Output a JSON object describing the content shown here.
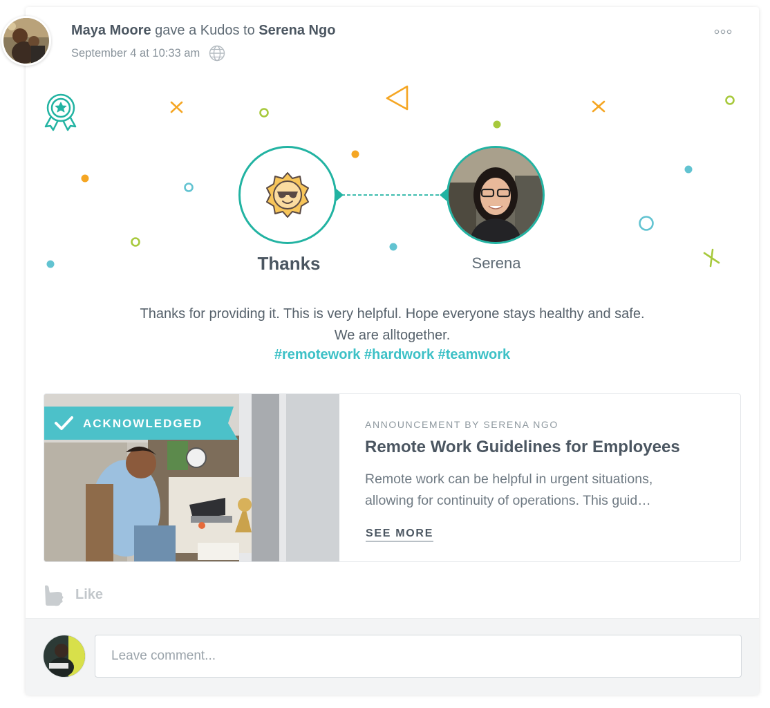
{
  "post": {
    "author": "Maya Moore",
    "action": "gave a Kudos to",
    "recipient": "Serena Ngo",
    "timestamp": "September 4 at 10:33 am",
    "visibility_icon": "globe-icon",
    "more_icon": "more-horizontal-icon"
  },
  "kudos": {
    "badge_icon": "award-ribbon-icon",
    "type_icon": "sun-sunglasses-icon",
    "type_label": "Thanks",
    "recipient_label": "Serena"
  },
  "message": {
    "line1": "Thanks for providing it. This is very helpful. Hope everyone stays healthy and safe.",
    "line2": "We are alltogether.",
    "hashtags": [
      "#remotework",
      "#hardwork",
      "#teamwork"
    ]
  },
  "announcement": {
    "badge_label": "ACKNOWLEDGED",
    "kicker": "ANNOUNCEMENT BY SERENA NGO",
    "title": "Remote Work Guidelines for Employees",
    "desc_line1": "Remote work can be helpful in urgent situations,",
    "desc_line2": "allowing for continuity of operations.  This guid…",
    "see_more": "SEE MORE"
  },
  "actions": {
    "like_label": "Like",
    "like_icon": "thumbs-up-icon"
  },
  "comment": {
    "placeholder": "Leave comment..."
  },
  "colors": {
    "accent_teal": "#22b3a2",
    "hashtag": "#3cc0c6",
    "banner": "#4cc1c9",
    "orange": "#f5a623",
    "lime": "#a7c93c",
    "sky": "#62c3d1"
  }
}
